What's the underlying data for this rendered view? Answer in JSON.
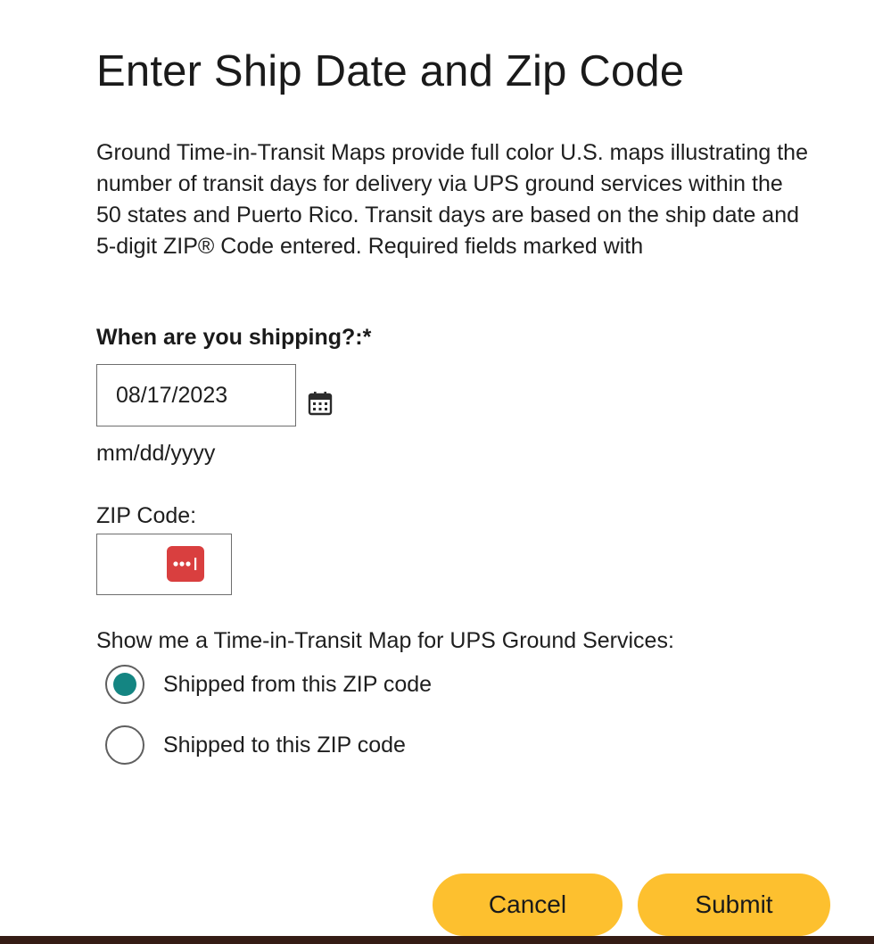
{
  "dialog": {
    "title": "Enter Ship Date and Zip Code",
    "intro": "Ground Time-in-Transit Maps provide full color U.S. maps illustrating the number of transit days for delivery via UPS ground services within the 50 states and Puerto Rico. Transit days are based on the ship date and 5-digit ZIP® Code entered. Required fields marked with"
  },
  "ship_date": {
    "label": "When are you shipping?:*",
    "value": "08/17/2023",
    "format_hint": "mm/dd/yyyy",
    "calendar_icon": "calendar-icon"
  },
  "zip": {
    "label": "ZIP Code:",
    "value": "",
    "autofill_icon": "password-manager-icon"
  },
  "map_option": {
    "label": "Show me a Time-in-Transit Map for UPS Ground Services:",
    "options": [
      {
        "label": "Shipped from this ZIP code",
        "selected": true
      },
      {
        "label": "Shipped to this ZIP code",
        "selected": false
      }
    ]
  },
  "actions": {
    "cancel_label": "Cancel",
    "submit_label": "Submit"
  },
  "colors": {
    "button_bg": "#fdc02f",
    "radio_selected": "#148582",
    "autofill_icon_bg": "#d93f3f",
    "footer_bar": "#351c15"
  }
}
